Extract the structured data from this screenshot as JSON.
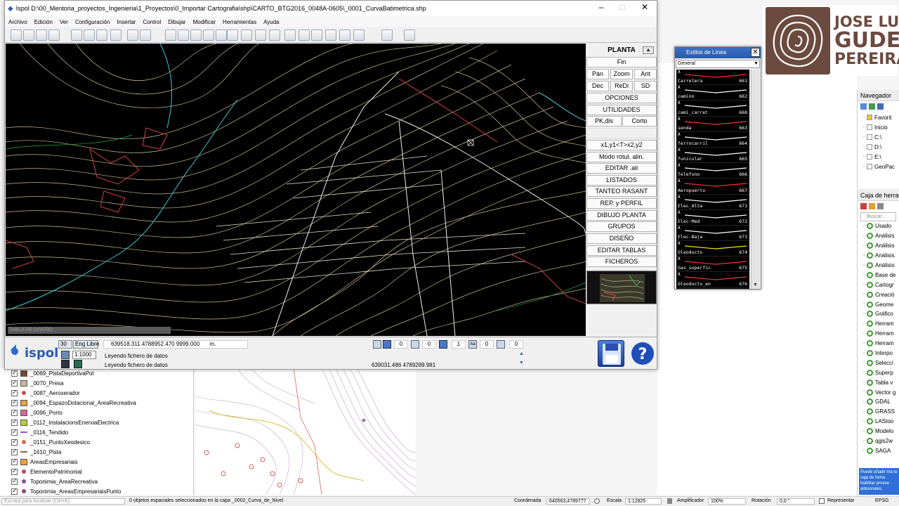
{
  "ispol": {
    "title": "Ispol  D:\\00_Mentoria_proyectos_Ingenieria\\1_Proyectos\\0_Importar Cartografia\\shp\\CARTO_BTG2016_0048A-0605\\_0001_CurvaBatimetrica.shp",
    "menu": [
      "Archivo",
      "Edición",
      "Ver",
      "Configuración",
      "Insertar",
      "Control",
      "Dibujar",
      "Modificar",
      "Herramientas",
      "Ayuda"
    ],
    "map_hint": "TABLA DE DISEÑO",
    "panel": {
      "title": "PLANTA",
      "fin": "Fin",
      "pan": "Pan",
      "zoom": "Zoom",
      "ant": "Ant",
      "dec": "Dec",
      "redi": "ReDi",
      "sd": "SD",
      "opciones": "OPCIONES",
      "utilidades": "UTILIDADES",
      "pkdis": "PK,dis",
      "corto": "Corto",
      "x1y1": "x1,y1<T>x2,y2",
      "modo_rotul": "Modo rotul. alin.",
      "editar_ali": "EDITAR .ali",
      "listados": "LISTADOS",
      "tanteo": "TANTEO RASANT",
      "rep_perfil": "REP. y PERFIL",
      "dibujo_planta": "DIBUJO PLANTA",
      "grupos": "GRUPOS",
      "diseno": "DISEÑO",
      "editar_tablas": "EDITAR TABLAS",
      "ficheros": "FICHEROS"
    },
    "bottom": {
      "box_30": "30",
      "eng_libre": "Eng Libre",
      "coords": "639518.311  4788952.470  9999.000",
      "unit": "m.",
      "scale": "1:1000",
      "msg1": "Leyendo fichero de datos",
      "msg2": "Leyendo fichero de datos",
      "coords2": "639031.486  4789289.981",
      "v1": "0",
      "v2": "0",
      "v3": "1",
      "v4": "0",
      "v5": "0",
      "logo": "ispol"
    }
  },
  "estilos": {
    "title": "Estilos de Línea",
    "select": "General",
    "items": [
      {
        "name": "Carretera",
        "code": "661",
        "color": "#ff2a2a"
      },
      {
        "name": "camino",
        "code": "662",
        "color": "#ffffff"
      },
      {
        "name": "cami_carret",
        "code": "668",
        "color": "#ffffff"
      },
      {
        "name": "senda",
        "code": "663",
        "color": "#ff3030"
      },
      {
        "name": "ferrocarril",
        "code": "664",
        "color": "#ffffff"
      },
      {
        "name": "funicular",
        "code": "665",
        "color": "#ffffff"
      },
      {
        "name": "Telefono",
        "code": "666",
        "color": "#ffffff"
      },
      {
        "name": "Aeropuerto",
        "code": "667",
        "color": "#ff3030"
      },
      {
        "name": "Elec_Alta",
        "code": "671",
        "color": "#ffffff"
      },
      {
        "name": "Elec-Med",
        "code": "672",
        "color": "#ffffff"
      },
      {
        "name": "Elec-Baja",
        "code": "673",
        "color": "#ffffff"
      },
      {
        "name": "Oleoducto",
        "code": "674",
        "color": "#ffe600"
      },
      {
        "name": "Gas_superfic",
        "code": "675",
        "color": "#ff3030"
      },
      {
        "name": "Oleoducto_en",
        "code": "676",
        "color": "#ff3030"
      }
    ]
  },
  "logo": {
    "line1": "JOSE LUIS",
    "line2": "GUDE",
    "line3": "PEREIRA"
  },
  "qgis": {
    "layers": [
      {
        "name": "_0069_PistaDeportivaPol",
        "swatch": "#7a4a2e",
        "kind": "poly"
      },
      {
        "name": "_0070_Presa",
        "swatch": "#c8b8a0",
        "kind": "poly"
      },
      {
        "name": "_0087_Aeroxerador",
        "swatch": "#d04848",
        "kind": "point"
      },
      {
        "name": "_0094_EspazoDotacional_AreaRecreativa",
        "swatch": "#e8a23c",
        "kind": "poly"
      },
      {
        "name": "_0096_Porto",
        "swatch": "#e060a0",
        "kind": "poly"
      },
      {
        "name": "_0112_InstalacionsEnerxiaElectrica",
        "swatch": "#b8d040",
        "kind": "poly"
      },
      {
        "name": "_0116_Tendido",
        "swatch": "#9a5ad0",
        "kind": "line"
      },
      {
        "name": "_0151_PuntoXeodesico",
        "swatch": "#d07048",
        "kind": "point"
      },
      {
        "name": "_1610_Pista",
        "swatch": "#8c6a3c",
        "kind": "line"
      },
      {
        "name": "AreasEmpresariais",
        "swatch": "#f0a030",
        "kind": "poly"
      },
      {
        "name": "ElementoPatrimonial",
        "swatch": "#b05050",
        "kind": "point"
      },
      {
        "name": "Toponimia_AreaRecreativa",
        "swatch": "#905090",
        "kind": "point"
      },
      {
        "name": "Toponimia_AreasEmpresariaisPunto",
        "swatch": "#904870",
        "kind": "point"
      }
    ],
    "navigator": {
      "title": "Navegador",
      "items": [
        "Favorit",
        "Inicio",
        "C:\\",
        "D:\\",
        "E:\\",
        "GeoPac"
      ]
    },
    "toolbox": {
      "title": "Caja de herra",
      "search": "Buscar...",
      "items": [
        "Usado",
        "Análisis",
        "Análisis",
        "Análisis",
        "Análisis",
        "Base de",
        "Cartogr",
        "Creació",
        "Geome",
        "Gráfico",
        "Herram",
        "Herram",
        "Herram",
        "Interpo",
        "Selecci",
        "Superp",
        "Tabla v",
        "Vector g",
        "GDAL",
        "GRASS",
        "LAStoo",
        "Modelo",
        "qgis2w",
        "SAGA"
      ],
      "note": "Puede añadir ma la caja de herra habilitar provee adicionales."
    },
    "status": {
      "search_placeholder": "Escriba para localizar (Ctrl+K)",
      "message": "0 objetos espaciales seleccionados en la capa _0002_Curva_de_Nivel.",
      "coord_label": "Coordenada",
      "coord_value": "640563,4789777",
      "scale_label": "Escala",
      "scale_value": "1:12825",
      "amp_label": "Amplificador",
      "amp_value": "100%",
      "rot_label": "Rotación",
      "rot_value": "0,0 °",
      "render_label": "Representar",
      "epsg": "EPSG"
    }
  }
}
